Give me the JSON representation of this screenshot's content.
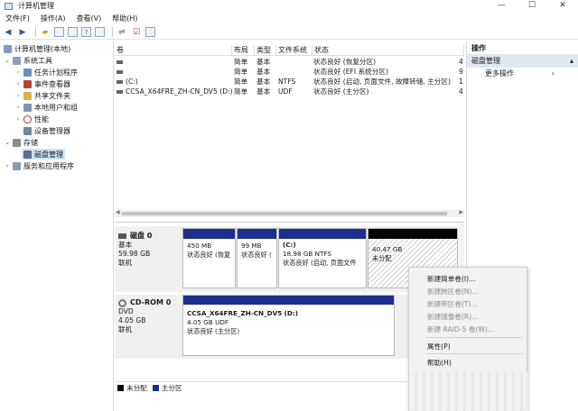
{
  "window": {
    "title": "计算机管理",
    "controls": {
      "minimize": "—",
      "maximize": "☐",
      "close": "✕"
    }
  },
  "menu": [
    "文件(F)",
    "操作(A)",
    "查看(V)",
    "帮助(H)"
  ],
  "tree": {
    "root": "计算机管理(本地)",
    "system_tools": "系统工具",
    "task_scheduler": "任务计划程序",
    "event_viewer": "事件查看器",
    "shared_folders": "共享文件夹",
    "local_users": "本地用户和组",
    "performance": "性能",
    "device_manager": "设备管理器",
    "storage": "存储",
    "disk_management": "磁盘管理",
    "services_apps": "服务和应用程序"
  },
  "volumes": {
    "headers": {
      "volume": "卷",
      "layout": "布局",
      "type": "类型",
      "fs": "文件系统",
      "status": "状态"
    },
    "rows": [
      {
        "name": "",
        "layout": "简单",
        "type": "基本",
        "fs": "",
        "status": "状态良好 (恢复分区)",
        "trail": "4"
      },
      {
        "name": "",
        "layout": "简单",
        "type": "基本",
        "fs": "",
        "status": "状态良好 (EFI 系统分区)",
        "trail": "9"
      },
      {
        "name": "(C:)",
        "layout": "简单",
        "type": "基本",
        "fs": "NTFS",
        "status": "状态良好 (启动, 页面文件, 故障转储, 主分区)",
        "trail": "1"
      },
      {
        "name": "CCSA_X64FRE_ZH-CN_DV5 (D:)",
        "layout": "简单",
        "type": "基本",
        "fs": "UDF",
        "status": "状态良好 (主分区)",
        "trail": "4"
      }
    ]
  },
  "disks": {
    "disk0": {
      "name": "磁盘 0",
      "kind": "基本",
      "size": "59.98 GB",
      "state": "联机",
      "partitions": [
        {
          "size": "450 MB",
          "status": "状态良好 (恢复",
          "style": "blue"
        },
        {
          "size": "99 MB",
          "status": "状态良好 (",
          "style": "blue"
        },
        {
          "label": "(C:)",
          "size": "18.98 GB NTFS",
          "status": "状态良好 (启动, 页面文件",
          "style": "blue"
        },
        {
          "size": "40.47 GB",
          "status": "未分配",
          "style": "black"
        }
      ]
    },
    "cdrom0": {
      "name": "CD-ROM 0",
      "kind": "DVD",
      "size": "4.05 GB",
      "state": "联机",
      "partition": {
        "label": "CCSA_X64FRE_ZH-CN_DV5 (D:)",
        "size": "4.05 GB UDF",
        "status": "状态良好 (主分区)"
      }
    }
  },
  "legend": {
    "unallocated": "未分配",
    "primary": "主分区",
    "unallocated_color": "#050505",
    "primary_color": "#1d2f8c"
  },
  "actions": {
    "title": "操作",
    "section": "磁盘管理",
    "more": "更多操作"
  },
  "context_menu": {
    "items": [
      {
        "label": "新建简单卷(I)...",
        "enabled": true
      },
      {
        "label": "新建跨区卷(N)...",
        "enabled": false
      },
      {
        "label": "新建带区卷(T)...",
        "enabled": false
      },
      {
        "label": "新建镜像卷(R)...",
        "enabled": false
      },
      {
        "label": "新建 RAID-5 卷(W)...",
        "enabled": false
      },
      {
        "label": "属性(P)",
        "enabled": true
      },
      {
        "label": "帮助(H)",
        "enabled": true
      }
    ]
  }
}
